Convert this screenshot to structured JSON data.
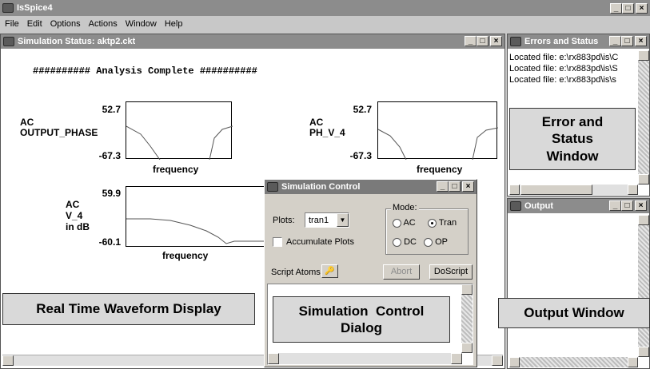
{
  "app": {
    "title": "IsSpice4"
  },
  "menu": [
    "File",
    "Edit",
    "Options",
    "Actions",
    "Window",
    "Help"
  ],
  "main_buttons": [
    "_",
    "□",
    "×"
  ],
  "sim_status": {
    "title": "Simulation Status: aktp2.ckt",
    "banner": "########## Analysis Complete ##########",
    "plots": [
      {
        "line1": "AC",
        "line2": "OUTPUT_PHASE",
        "line3": "",
        "top": "52.7",
        "bottom": "-67.3",
        "xlabel": "frequency"
      },
      {
        "line1": "AC",
        "line2": "PH_V_4",
        "line3": "",
        "top": "52.7",
        "bottom": "-67.3",
        "xlabel": "frequency"
      },
      {
        "line1": "AC",
        "line2": "V_4",
        "line3": "in dB",
        "top": "59.9",
        "bottom": "-60.1",
        "xlabel": "frequency"
      }
    ],
    "callout": "Real Time Waveform Display"
  },
  "errors": {
    "title": "Errors and Status",
    "lines": [
      "Located file: e:\\rx883pd\\is\\C",
      "Located file: e:\\rx883pd\\is\\S",
      "Located file: e:\\rx883pd\\is\\s"
    ],
    "callout_l1": "Error and",
    "callout_l2": "Status",
    "callout_l3": "Window"
  },
  "output": {
    "title": "Output",
    "callout": "Output Window"
  },
  "sim_control": {
    "title": "Simulation Control",
    "plots_label": "Plots:",
    "plots_value": "tran1",
    "accumulate": "Accumulate Plots",
    "mode_label": "Mode:",
    "mode_ac": "AC",
    "mode_tran": "Tran",
    "mode_dc": "DC",
    "mode_op": "OP",
    "mode_selected": "Tran",
    "script_atoms": "Script Atoms",
    "abort": "Abort",
    "doscript": "DoScript",
    "callout_l1": "Simulation  Control",
    "callout_l2": "Dialog"
  }
}
